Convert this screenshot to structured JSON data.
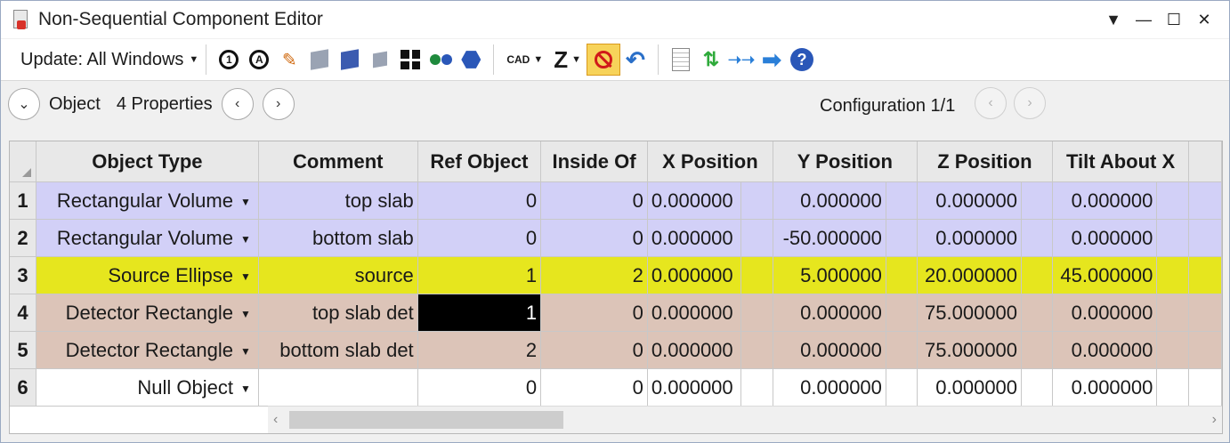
{
  "window": {
    "title": "Non-Sequential Component Editor"
  },
  "toolbar": {
    "update_label": "Update: All Windows",
    "cad_label": "CAD",
    "z_label": "Z"
  },
  "propbar": {
    "section": "Object",
    "properties": "4 Properties",
    "configuration": "Configuration 1/1"
  },
  "grid": {
    "headers": [
      "Object Type",
      "Comment",
      "Ref Object",
      "Inside Of",
      "X Position",
      "Y Position",
      "Z Position",
      "Tilt About X"
    ],
    "rows": [
      {
        "num": "1",
        "type": "Rectangular Volume",
        "comment": "top slab",
        "ref": "0",
        "inside": "0",
        "x": "0.000000",
        "y": "0.000000",
        "z": "0.000000",
        "tiltx": "0.000000",
        "color": "lavender"
      },
      {
        "num": "2",
        "type": "Rectangular Volume",
        "comment": "bottom slab",
        "ref": "0",
        "inside": "0",
        "x": "0.000000",
        "y": "-50.000000",
        "z": "0.000000",
        "tiltx": "0.000000",
        "color": "lavender"
      },
      {
        "num": "3",
        "type": "Source Ellipse",
        "comment": "source",
        "ref": "1",
        "inside": "2",
        "x": "0.000000",
        "y": "5.000000",
        "z": "20.000000",
        "tiltx": "45.000000",
        "color": "yellow"
      },
      {
        "num": "4",
        "type": "Detector Rectangle",
        "comment": "top slab det",
        "ref": "1",
        "inside": "0",
        "x": "0.000000",
        "y": "0.000000",
        "z": "75.000000",
        "tiltx": "0.000000",
        "color": "rose"
      },
      {
        "num": "5",
        "type": "Detector Rectangle",
        "comment": "bottom slab det",
        "ref": "2",
        "inside": "0",
        "x": "0.000000",
        "y": "0.000000",
        "z": "75.000000",
        "tiltx": "0.000000",
        "color": "rose"
      },
      {
        "num": "6",
        "type": "Null Object",
        "comment": "",
        "ref": "0",
        "inside": "0",
        "x": "0.000000",
        "y": "0.000000",
        "z": "0.000000",
        "tiltx": "0.000000",
        "color": "white"
      }
    ]
  },
  "colors": {
    "lavender": "#d2d0f7",
    "yellow": "#e6e61e",
    "rose": "#dcc4b8",
    "white": "#ffffff"
  }
}
